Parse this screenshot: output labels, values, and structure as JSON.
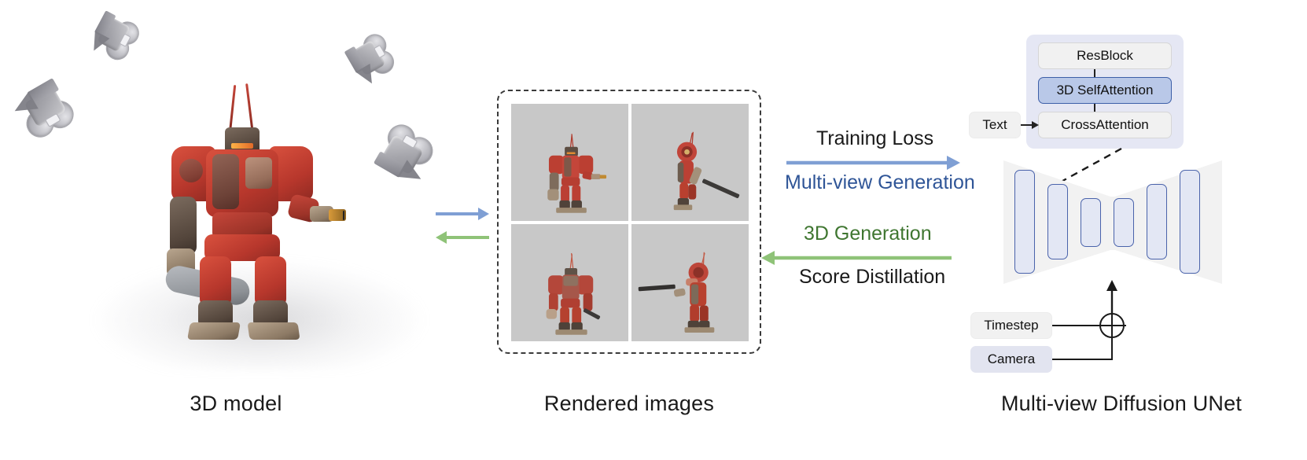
{
  "figure": {
    "title": "Multi-view diffusion pipeline overview",
    "background_color": "#ffffff"
  },
  "panels": [
    {
      "id": "3d-model",
      "caption": "3D model"
    },
    {
      "id": "rendered",
      "caption": "Rendered images"
    },
    {
      "id": "unet",
      "caption": "Multi-view Diffusion UNet"
    }
  ],
  "captions": {
    "left": "3D model",
    "middle": "Rendered images",
    "right": "Multi-view Diffusion UNet"
  },
  "model_panel": {
    "subject": "red mech robot 3D asset",
    "cameras": [
      {
        "name": "camera-top-left"
      },
      {
        "name": "camera-top-right"
      },
      {
        "name": "camera-left"
      },
      {
        "name": "camera-right"
      }
    ]
  },
  "rendered_panel": {
    "frame_style": "dashed",
    "tile_background": "#c8c8c8",
    "views": [
      {
        "name": "view-front",
        "pose": "front facing, arms out"
      },
      {
        "name": "view-right",
        "pose": "side view holding sword"
      },
      {
        "name": "view-back",
        "pose": "back view"
      },
      {
        "name": "view-left",
        "pose": "three-quarter view with sword"
      }
    ]
  },
  "flows": {
    "small_forward": {
      "name": "render-forward-arrow",
      "color": "#7f9fd4",
      "direction": "right"
    },
    "small_backward": {
      "name": "render-backward-arrow",
      "color": "#8fc378",
      "direction": "left"
    },
    "forward": {
      "top_label": "Training Loss",
      "bottom_label": "Multi-view Generation",
      "color": "#7f9fd4",
      "label_color": "#2f5597",
      "direction": "right"
    },
    "backward": {
      "top_label": "3D Generation",
      "bottom_label": "Score Distillation",
      "color": "#8fc378",
      "label_color": "#3f7630",
      "direction": "left"
    }
  },
  "unet": {
    "attention_stack": [
      {
        "label": "ResBlock",
        "highlighted": false
      },
      {
        "label": "3D SelfAttention",
        "highlighted": true
      },
      {
        "label": "CrossAttention",
        "highlighted": false
      }
    ],
    "highlight_color": "#b9c8e8",
    "highlight_border": "#3d5fa8",
    "group_background": "#e5e7f4",
    "inputs": [
      {
        "label": "Text",
        "target": "CrossAttention",
        "style": "grey"
      },
      {
        "label": "Timestep",
        "target": "unet-bottleneck",
        "style": "grey"
      },
      {
        "label": "Camera",
        "target": "unet-bottleneck",
        "style": "blue-grey"
      }
    ],
    "combine_operator": "⊕",
    "block_count": 6,
    "block_fill": "#e3e7f4",
    "block_border": "#4a63ab",
    "backbone_fill": "#f2f2f2",
    "connector_style": "dashed"
  }
}
